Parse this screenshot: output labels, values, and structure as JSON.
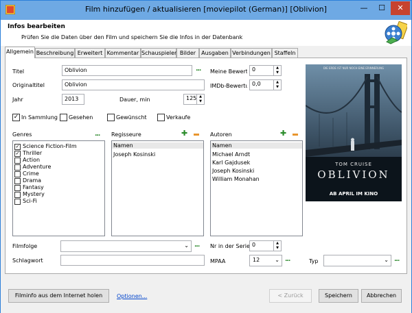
{
  "window": {
    "title": "Film hinzufügen / aktualisieren [moviepilot (German)] [Oblivion]",
    "minimize": "—",
    "maximize": "☐",
    "close": "✕"
  },
  "header": {
    "title": "Infos bearbeiten",
    "subtitle": "Prüfen Sie die Daten über den Film und speichern Sie die Infos in der Datenbank"
  },
  "tabs": [
    "Allgemein",
    "Beschreibung",
    "Erweitert",
    "Kommentar",
    "Schauspieler",
    "Bilder",
    "Ausgaben",
    "Verbindungen",
    "Staffeln"
  ],
  "fields": {
    "titel_label": "Titel",
    "titel_value": "Oblivion",
    "originaltitel_label": "Originaltitel",
    "originaltitel_value": "Oblivion",
    "jahr_label": "Jahr",
    "jahr_value": "2013",
    "dauer_label": "Dauer, min",
    "dauer_value": "125",
    "bewertung_label": "Meine Bewertung",
    "bewertung_value": "0",
    "imdb_label": "IMDb-Bewertung",
    "imdb_value": "0,0",
    "more_dots": "..."
  },
  "checks": {
    "in_sammlung": "In Sammlung",
    "in_sammlung_checked": true,
    "gesehen": "Gesehen",
    "gewuenscht": "Gewünscht",
    "verkaufe": "Verkaufe"
  },
  "genres": {
    "label": "Genres",
    "items": [
      {
        "name": "Science Fiction-Film",
        "checked": true
      },
      {
        "name": "Thriller",
        "checked": true
      },
      {
        "name": "Action",
        "checked": false
      },
      {
        "name": "Adventure",
        "checked": false
      },
      {
        "name": "Crime",
        "checked": false
      },
      {
        "name": "Drama",
        "checked": false
      },
      {
        "name": "Fantasy",
        "checked": false
      },
      {
        "name": "Mystery",
        "checked": false
      },
      {
        "name": "Sci-Fi",
        "checked": false
      }
    ]
  },
  "regisseure": {
    "label": "Regisseure",
    "header": "Namen",
    "items": [
      "Joseph Kosinski"
    ]
  },
  "autoren": {
    "label": "Autoren",
    "header": "Namen",
    "items": [
      "Michael Arndt",
      "Karl Gajdusek",
      "Joseph Kosinski",
      "William Monahan"
    ]
  },
  "poster": {
    "top_text": "DIE ERDE IST NUR NOCH EINE ERINNERUNG",
    "actor": "TOM CRUISE",
    "title": "OBLIVION",
    "release": "AB APRIL IM KINO"
  },
  "bottom_fields": {
    "filmfolge_label": "Filmfolge",
    "schlagwort_label": "Schlagwort",
    "nr_serie_label": "Nr in der Serie",
    "nr_serie_value": "0",
    "mpaa_label": "MPAA",
    "mpaa_value": "12",
    "typ_label": "Typ"
  },
  "buttons": {
    "internet": "Filminfo aus dem Internet holen",
    "optionen": "Optionen...",
    "zurueck": "< Zurück",
    "speichern": "Speichern",
    "abbrechen": "Abbrechen"
  }
}
